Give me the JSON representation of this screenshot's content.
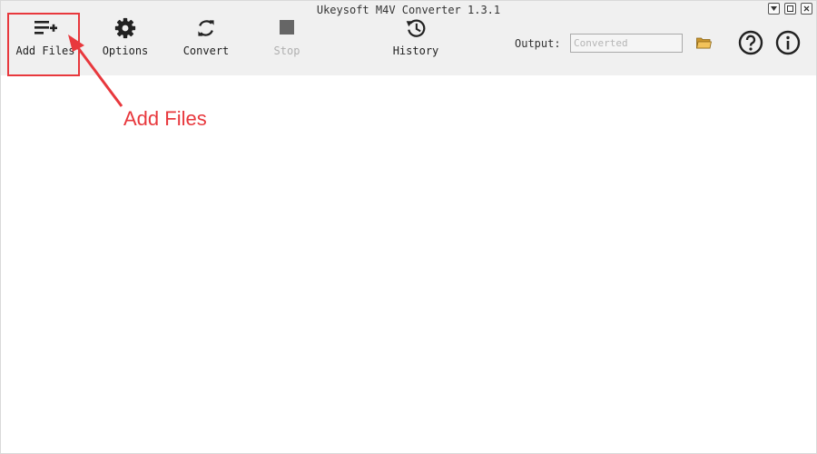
{
  "window": {
    "title": "Ukeysoft M4V Converter 1.3.1",
    "controls": [
      "dropdown",
      "minimize",
      "close"
    ]
  },
  "toolbar": {
    "items": [
      {
        "label": "Add Files",
        "icon": "add-list-icon",
        "enabled": true
      },
      {
        "label": "Options",
        "icon": "gear-icon",
        "enabled": true
      },
      {
        "label": "Convert",
        "icon": "refresh-icon",
        "enabled": true
      },
      {
        "label": "Stop",
        "icon": "stop-icon",
        "enabled": false
      },
      {
        "label": "History",
        "icon": "history-icon",
        "enabled": true
      }
    ],
    "output_label": "Output:",
    "output_value": "Converted",
    "folder_icon": "folder-icon",
    "help_icon": "help-icon",
    "info_icon": "info-icon"
  },
  "annotation": {
    "text": "Add Files",
    "color": "#e8383d"
  },
  "colors": {
    "toolbar_bg": "#f0f0f0",
    "accent_red": "#e8383d",
    "disabled": "#b0b0b0"
  }
}
